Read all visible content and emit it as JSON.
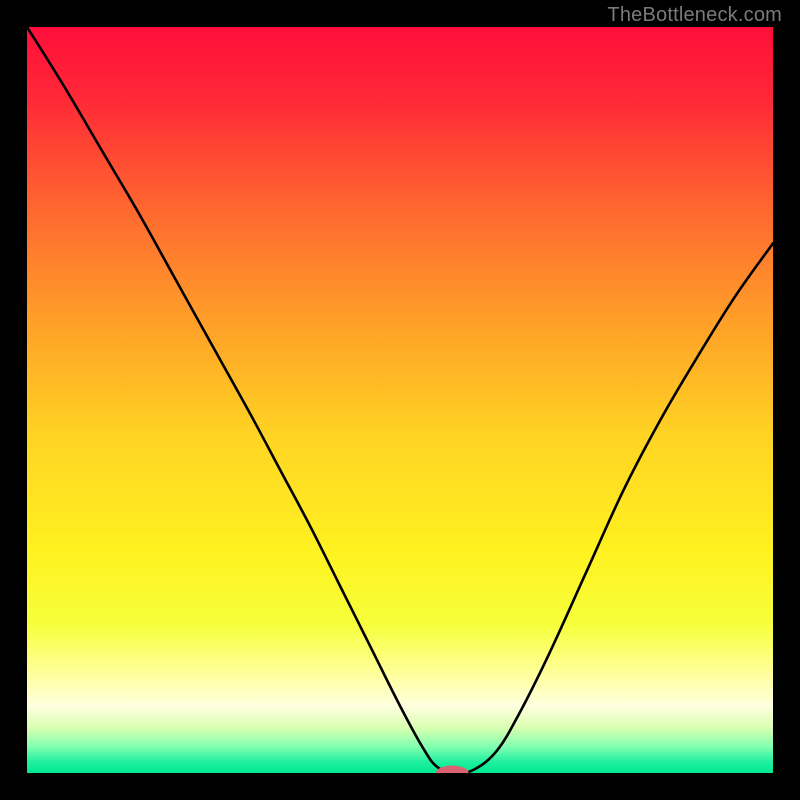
{
  "watermark": "TheBottleneck.com",
  "chart_data": {
    "type": "line",
    "title": "",
    "xlabel": "",
    "ylabel": "",
    "xlim": [
      0,
      100
    ],
    "ylim": [
      0,
      100
    ],
    "series": [
      {
        "name": "curve",
        "x": [
          0,
          5,
          10,
          15,
          20,
          25,
          30,
          34,
          38,
          42,
          46,
          50,
          53,
          55,
          57.5,
          60,
          63,
          66,
          70,
          75,
          80,
          85,
          90,
          95,
          100
        ],
        "y": [
          100,
          92,
          83.5,
          75,
          66,
          57,
          48,
          40.5,
          33,
          25,
          17,
          9,
          3.5,
          0.8,
          0,
          0.5,
          3,
          8,
          16,
          27,
          38,
          47.5,
          56,
          64,
          71
        ]
      }
    ],
    "background": {
      "type": "vertical-gradient",
      "stops": [
        {
          "offset": 0.0,
          "color": "#ff0e3a"
        },
        {
          "offset": 0.1,
          "color": "#ff2a37"
        },
        {
          "offset": 0.25,
          "color": "#ff6a2f"
        },
        {
          "offset": 0.4,
          "color": "#ffa128"
        },
        {
          "offset": 0.55,
          "color": "#ffd423"
        },
        {
          "offset": 0.7,
          "color": "#fff120"
        },
        {
          "offset": 0.8,
          "color": "#f6ff3a"
        },
        {
          "offset": 0.87,
          "color": "#ffffa0"
        },
        {
          "offset": 0.91,
          "color": "#ffffe0"
        },
        {
          "offset": 0.94,
          "color": "#d8ffb0"
        },
        {
          "offset": 0.965,
          "color": "#80ffb0"
        },
        {
          "offset": 0.985,
          "color": "#20f0a0"
        },
        {
          "offset": 1.0,
          "color": "#00e890"
        }
      ]
    },
    "marker": {
      "x": 57,
      "y": 0,
      "rx": 2.2,
      "ry": 1.0,
      "color": "#d9636f"
    }
  }
}
